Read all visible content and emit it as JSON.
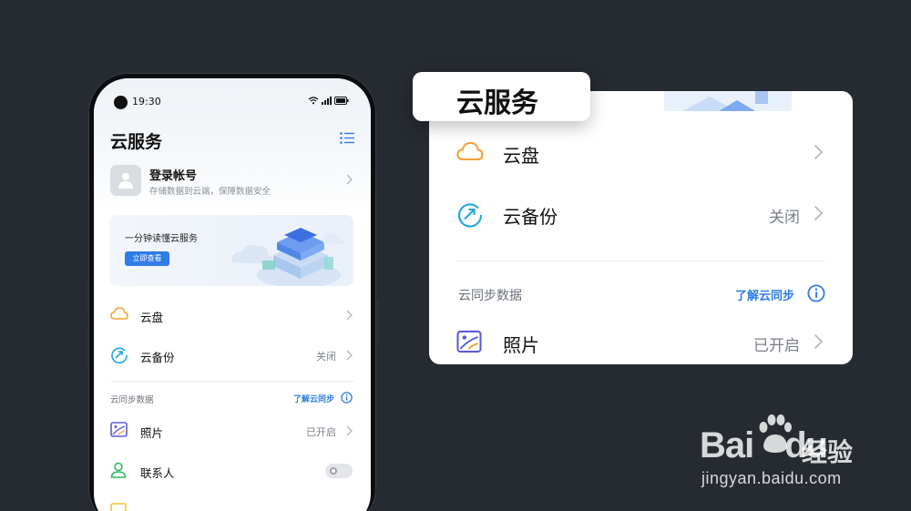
{
  "phone": {
    "status": {
      "time": "19:30"
    },
    "title": "云服务",
    "login": {
      "name": "登录帐号",
      "subtitle": "存储数据到云端，保障数据安全"
    },
    "banner": {
      "text": "一分钟读懂云服务",
      "button": "立即查看"
    },
    "items": [
      {
        "label": "云盘",
        "value": "",
        "icon": "cloud-icon"
      },
      {
        "label": "云备份",
        "value": "关闭",
        "icon": "sync-icon"
      }
    ],
    "sync_section": {
      "title": "云同步数据",
      "link": "了解云同步"
    },
    "sync_items": [
      {
        "label": "照片",
        "value": "已开启",
        "icon": "photo-icon"
      },
      {
        "label": "联系人",
        "value": "",
        "icon": "contact-icon",
        "toggle": false
      }
    ]
  },
  "zoom": {
    "title": "云服务",
    "items": [
      {
        "label": "云盘",
        "value": ""
      },
      {
        "label": "云备份",
        "value": "关闭"
      }
    ],
    "sync_section": {
      "title": "云同步数据",
      "link": "了解云同步"
    },
    "sync_items": [
      {
        "label": "照片",
        "value": "已开启"
      }
    ]
  },
  "watermark": {
    "logo": "Bai",
    "logo2": "du",
    "cn": "经验",
    "url": "jingyan.baidu.com"
  },
  "colors": {
    "background": "#262a31",
    "accent": "#2f7ce6",
    "cloud": "#f5a033",
    "sync": "#1ea6e6",
    "photo": "#5b5bd6",
    "contact": "#2fb85a"
  }
}
